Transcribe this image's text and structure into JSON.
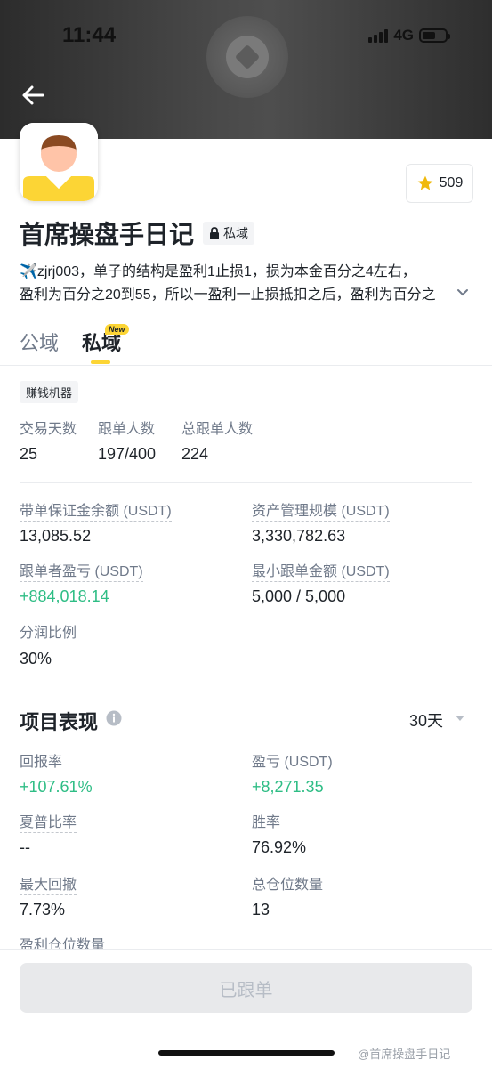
{
  "status_bar": {
    "time": "11:44",
    "network": "4G"
  },
  "profile": {
    "title": "首席操盘手日记",
    "private_tag": "私域",
    "favorites": "509",
    "bio_line1": "✈️zjrj003，单子的结构是盈利1止损1，损为本金百分之4左右，",
    "bio_line2": "盈利为百分之20到55，所以一盈利一止损抵扣之后，盈利为百分之"
  },
  "tabs": {
    "public": "公域",
    "private": "私域",
    "new_badge": "New"
  },
  "label_chip": "赚钱机器",
  "stats": {
    "trade_days_label": "交易天数",
    "trade_days": "25",
    "followers_label": "跟单人数",
    "followers": "197/400",
    "total_followers_label": "总跟单人数",
    "total_followers": "224"
  },
  "fund": {
    "margin_label": "带单保证金余额 (USDT)",
    "margin": "13,085.52",
    "aum_label": "资产管理规模 (USDT)",
    "aum": "3,330,782.63",
    "follower_pnl_label": "跟单者盈亏 (USDT)",
    "follower_pnl": "+884,018.14",
    "min_copy_label": "最小跟单金额 (USDT)",
    "min_copy": "5,000 / 5,000",
    "profit_share_label": "分润比例",
    "profit_share": "30%"
  },
  "performance": {
    "title": "项目表现",
    "period": "30天",
    "roi_label": "回报率",
    "roi": "+107.61%",
    "pnl_label": "盈亏 (USDT)",
    "pnl": "+8,271.35",
    "sharpe_label": "夏普比率",
    "sharpe": "--",
    "win_rate_label": "胜率",
    "win_rate": "76.92%",
    "mdd_label": "最大回撤",
    "mdd": "7.73%",
    "positions_label": "总仓位数量",
    "positions": "13",
    "profit_positions_label": "盈利仓位数量"
  },
  "footer": {
    "button": "已跟单",
    "watermark": "@首席操盘手日记"
  },
  "colors": {
    "accent": "#fcd535",
    "positive": "#2ebd85",
    "text": "#1e2329",
    "muted": "#707a8a"
  },
  "icons": [
    "back-arrow-icon",
    "star-icon",
    "lock-icon",
    "chevron-down-icon",
    "info-icon",
    "caret-down-icon"
  ]
}
